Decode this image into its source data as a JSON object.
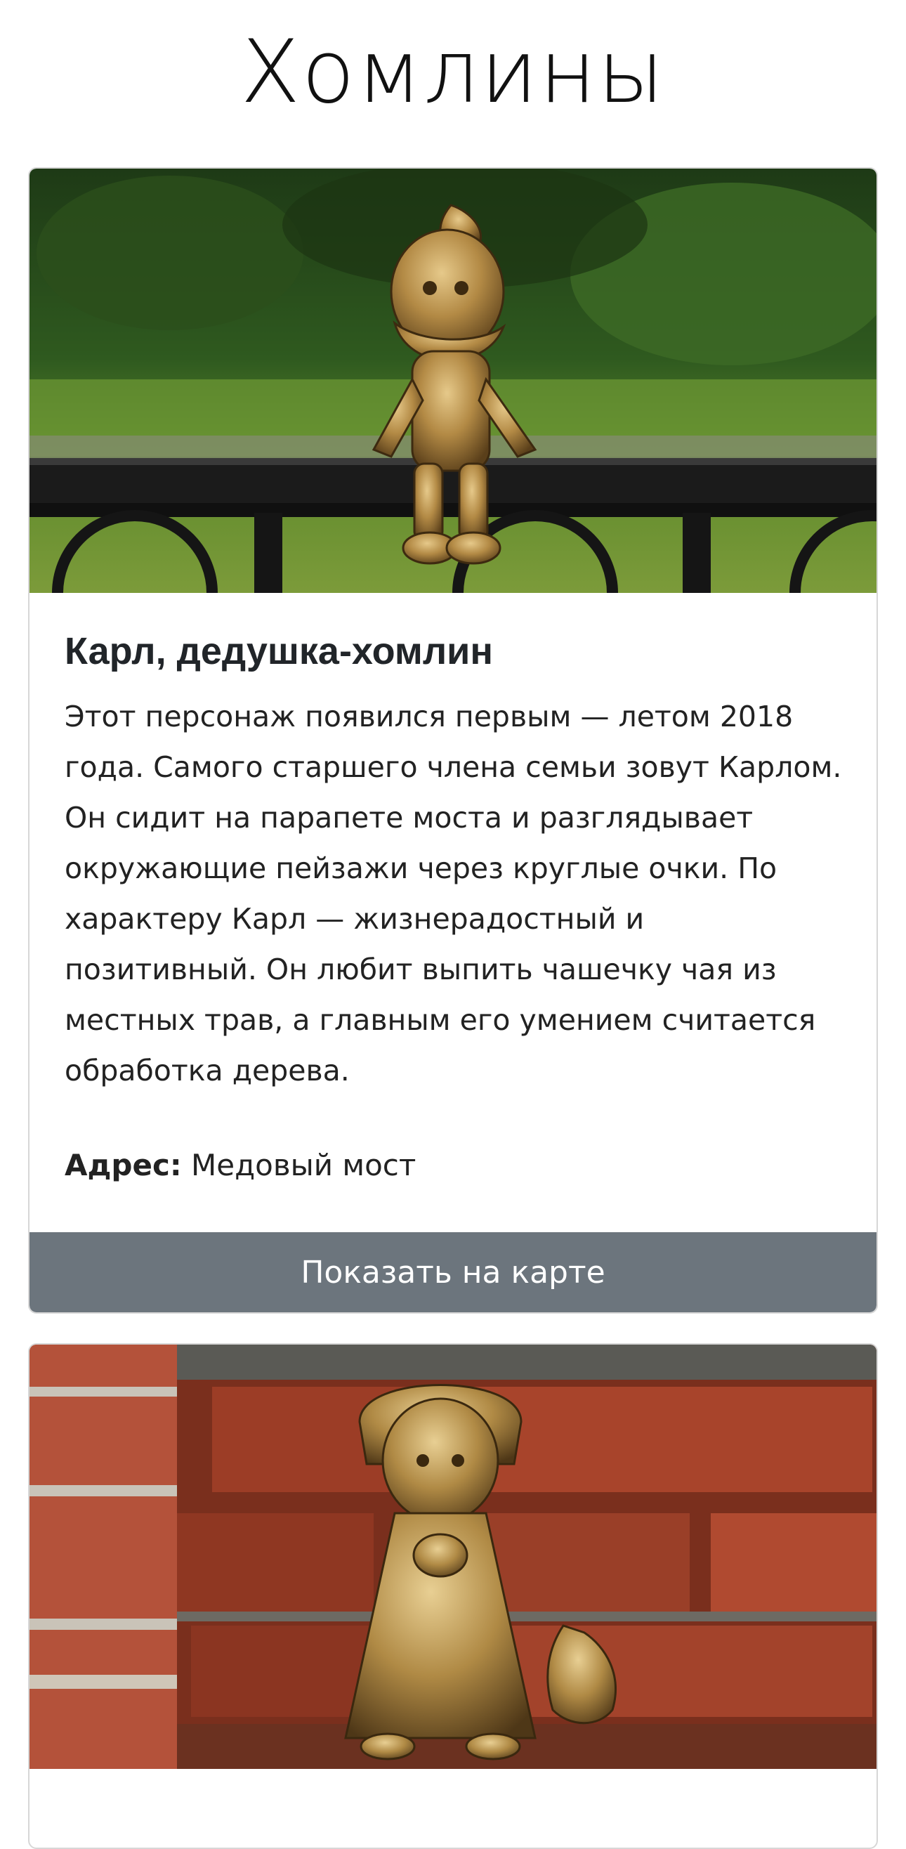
{
  "page": {
    "title": "Хомлины"
  },
  "cards": [
    {
      "title": "Карл, дедушка-хомлин",
      "description": "Этот персонаж появился первым — летом 2018 года. Самого старшего члена семьи зовут Карлом. Он сидит на парапете моста и разглядывает окружающие пейзажи через круглые очки. По характеру Карл — жизнерадостный и позитивный. Он любит выпить чашечку чая из местных трав, а главным его умением считается обработка дерева.",
      "address_label": "Адрес:",
      "address_value": "Медовый мост",
      "button_label": "Показать на карте",
      "image_icon": "bronze-gnome-on-railing"
    },
    {
      "image_icon": "bronze-gnome-woman-by-brick-wall"
    }
  ],
  "colors": {
    "button_bg": "#6c757d",
    "button_text": "#ffffff",
    "card_border": "#d7d7d7"
  }
}
